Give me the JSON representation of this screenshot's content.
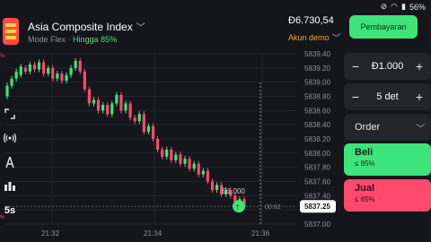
{
  "status_bar": {
    "time": "",
    "battery": "56%"
  },
  "asset": {
    "name": "Asia Composite Index",
    "mode": "Mode Flex",
    "payout_prefix": "Hingga",
    "payout": "85%"
  },
  "account": {
    "balance": "Đ6.730,54",
    "type": "Akun demo",
    "deposit_label": "Pembayaran"
  },
  "trade": {
    "amount": "Đ1.000",
    "duration": "5 det",
    "order_label": "Order",
    "buy": {
      "label": "Beli",
      "payout": "≤ 85%"
    },
    "sell": {
      "label": "Jual",
      "payout": "≤ 85%"
    }
  },
  "tools": {
    "timeframe": "5s",
    "icons": [
      "expand-icon",
      "signal-icon",
      "drawing-compass-icon",
      "indicators-icon"
    ]
  },
  "colors": {
    "up": "#3ee37a",
    "down": "#ff4a6e",
    "accent": "#3ee37a",
    "account": "#ff9f2e"
  },
  "chart_data": {
    "type": "candlestick",
    "x_ticks": [
      "21:32",
      "21:34",
      "21:36"
    ],
    "y_ticks": [
      "5839.40",
      "5839.20",
      "5839.00",
      "5838.80",
      "5838.60",
      "5838.40",
      "5838.20",
      "5838.00",
      "5837.80",
      "5837.60",
      "5837.40",
      "5837.20",
      "5837.00"
    ],
    "ylim": [
      5837.0,
      5839.4
    ],
    "current_price": "5837.25",
    "countdown": "00:02",
    "trade_marker_amount": "Đ1.000",
    "candles": [
      [
        5838.8,
        5838.95
      ],
      [
        5838.95,
        5839.05
      ],
      [
        5839.05,
        5839.15
      ],
      [
        5839.1,
        5839.22
      ],
      [
        5839.2,
        5839.15
      ],
      [
        5839.15,
        5839.25
      ],
      [
        5839.25,
        5839.18
      ],
      [
        5839.18,
        5839.28
      ],
      [
        5839.28,
        5839.12
      ],
      [
        5839.12,
        5839.2
      ],
      [
        5839.2,
        5839.05
      ],
      [
        5839.05,
        5839.12
      ],
      [
        5839.12,
        5839.02
      ],
      [
        5839.02,
        5839.1
      ],
      [
        5839.1,
        5839.2
      ],
      [
        5839.2,
        5839.3
      ],
      [
        5839.3,
        5839.15
      ],
      [
        5839.15,
        5838.9
      ],
      [
        5838.9,
        5838.7
      ],
      [
        5838.7,
        5838.75
      ],
      [
        5838.75,
        5838.6
      ],
      [
        5838.6,
        5838.68
      ],
      [
        5838.68,
        5838.55
      ],
      [
        5838.55,
        5838.7
      ],
      [
        5838.7,
        5838.82
      ],
      [
        5838.82,
        5838.6
      ],
      [
        5838.6,
        5838.7
      ],
      [
        5838.7,
        5838.5
      ],
      [
        5838.5,
        5838.45
      ],
      [
        5838.45,
        5838.55
      ],
      [
        5838.55,
        5838.3
      ],
      [
        5838.3,
        5838.38
      ],
      [
        5838.38,
        5838.2
      ],
      [
        5838.2,
        5838.05
      ],
      [
        5838.05,
        5837.95
      ],
      [
        5837.95,
        5838.05
      ],
      [
        5838.05,
        5837.9
      ],
      [
        5837.9,
        5837.98
      ],
      [
        5837.98,
        5837.85
      ],
      [
        5837.85,
        5837.92
      ],
      [
        5837.92,
        5837.78
      ],
      [
        5837.78,
        5837.85
      ],
      [
        5837.85,
        5837.7
      ],
      [
        5837.7,
        5837.75
      ],
      [
        5837.75,
        5837.6
      ],
      [
        5837.6,
        5837.48
      ],
      [
        5837.48,
        5837.55
      ],
      [
        5837.55,
        5837.42
      ],
      [
        5837.42,
        5837.48
      ],
      [
        5837.48,
        5837.4
      ],
      [
        5837.4,
        5837.3
      ],
      [
        5837.3,
        5837.35
      ],
      [
        5837.35,
        5837.25
      ]
    ]
  }
}
